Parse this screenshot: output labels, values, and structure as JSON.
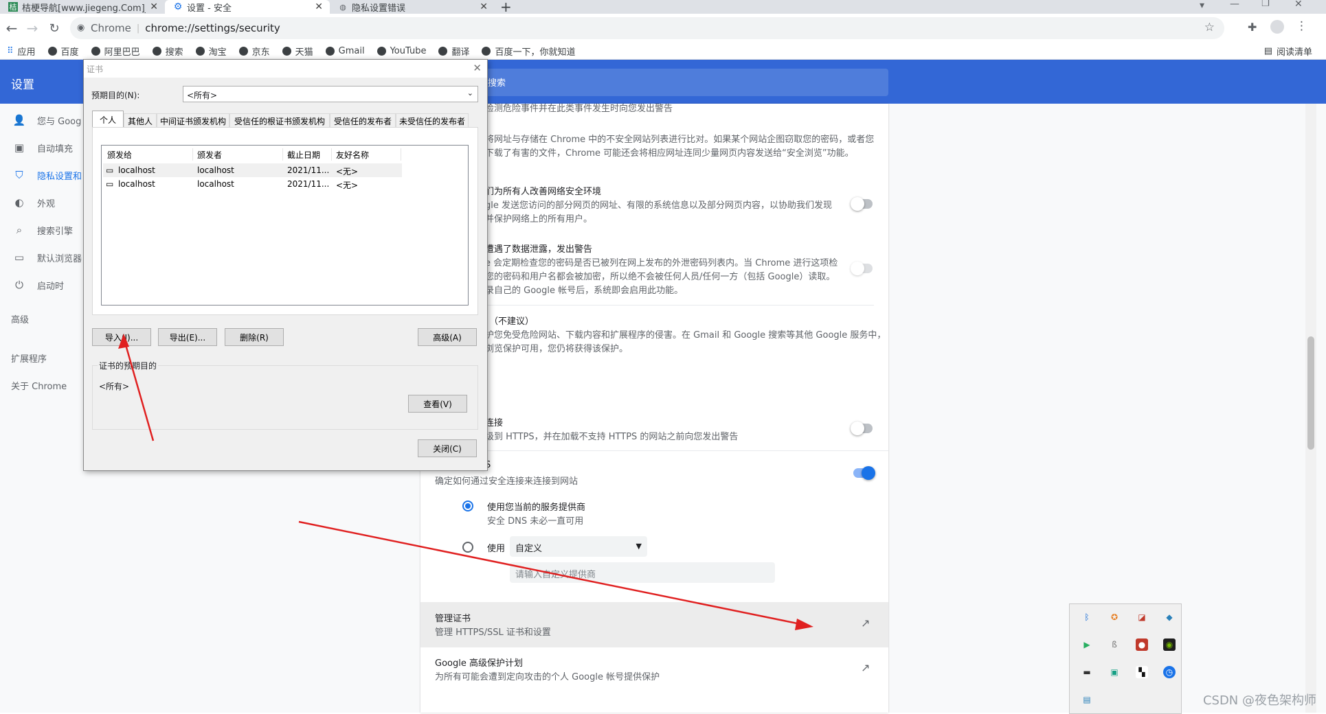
{
  "tabs": [
    {
      "title": "桔梗导航[www.jiegeng.Com]_",
      "close": "✕"
    },
    {
      "title": "设置 - 安全",
      "close": "✕"
    },
    {
      "title": "隐私设置错误",
      "close": "✕"
    }
  ],
  "new_tab": "+",
  "window_controls": {
    "minimize": "—",
    "restore": "❐",
    "close": "✕"
  },
  "omnibox": {
    "site": "Chrome",
    "url": "chrome://settings/security"
  },
  "bookmarks": [
    "应用",
    "百度",
    "阿里巴巴",
    "搜索",
    "淘宝",
    "京东",
    "天猫",
    "Gmail",
    "YouTube",
    "翻译",
    "百度一下，你就知道"
  ],
  "reading_list": "阅读清单",
  "settings_title": "设置",
  "search_placeholder": "搜索",
  "sidebar": [
    {
      "label": "您与 Goog"
    },
    {
      "label": "自动填充"
    },
    {
      "label": "隐私设置和"
    },
    {
      "label": "外观"
    },
    {
      "label": "搜索引擎"
    },
    {
      "label": "默认浏览器"
    },
    {
      "label": "启动时"
    }
  ],
  "sidebar_advanced": "高级",
  "sidebar_extensions": "扩展程序",
  "sidebar_about": "关于 Chrome",
  "content": {
    "l1": "检测危险事件并在此类事件发生时向您发出警告",
    "l2a": "将网址与存储在 Chrome 中的不安全网站列表进行比对。如果某个网站企图窃取您的密码，或者您",
    "l2b": "下载了有害的文件，Chrome 可能还会将相应网址连同少量网页内容发送给“安全浏览”功能。",
    "improve_title": "们为所有人改善网络安全环境",
    "improve_a": "gle 发送您访问的部分网页的网址、有限的系统信息以及部分网页内容，以协助我们发现",
    "improve_b": "并保护网络上的所有用户。",
    "leak_title": "遭遇了数据泄露，发出警告",
    "leak_a": "e 会定期检查您的密码是否已被列在网上发布的外泄密码列表内。当 Chrome 进行这项检",
    "leak_b": "您的密码和用户名都会被加密，所以绝不会被任何人员/任何一方（包括 Google）读取。",
    "leak_c": "录自己的 Google 帐号后，系统即会启用此功能。",
    "noprot_title": "（不建议）",
    "noprot_a": "护您免受危险网站、下载内容和扩展程序的侵害。在 Gmail 和 Google 搜索等其他 Google 服务中，",
    "noprot_b": "浏览保护可用，您仍将获得该保护。",
    "https_title": "连接",
    "https_sub": "级到 HTTPS，并在加载不支持 HTTPS 的网站之前向您发出警告",
    "dns_title": "S",
    "dns_sub": "确定如何通过安全连接来连接到网站",
    "dns_opt1": "使用您当前的服务提供商",
    "dns_opt1_sub": "安全 DNS 未必一直可用",
    "dns_opt2": "使用",
    "dns_select": "自定义",
    "dns_input_placeholder": "请输入自定义提供商",
    "manage_cert_title": "管理证书",
    "manage_cert_sub": "管理 HTTPS/SSL 证书和设置",
    "gapp_title": "Google 高级保护计划",
    "gapp_sub": "为所有可能会遭到定向攻击的个人 Google 帐号提供保护"
  },
  "dialog": {
    "title": "证书",
    "purpose_label": "预期目的(N):",
    "purpose_value": "<所有>",
    "tabs": [
      "个人",
      "其他人",
      "中间证书颁发机构",
      "受信任的根证书颁发机构",
      "受信任的发布者",
      "未受信任的发布者"
    ],
    "columns": [
      "颁发给",
      "颁发者",
      "截止日期",
      "友好名称"
    ],
    "rows": [
      [
        "localhost",
        "localhost",
        "2021/11...",
        "<无>"
      ],
      [
        "localhost",
        "localhost",
        "2021/11...",
        "<无>"
      ]
    ],
    "btn_import": "导入(I)...",
    "btn_export": "导出(E)...",
    "btn_remove": "删除(R)",
    "btn_advanced": "高级(A)",
    "group_label": "证书的预期目的",
    "group_value": "<所有>",
    "btn_view": "查看(V)",
    "btn_close": "关闭(C)"
  },
  "watermark": "CSDN @夜色架构师",
  "colors": {
    "accent": "#1a73e8",
    "header": "#3367d6",
    "arrow": "#e02020"
  }
}
